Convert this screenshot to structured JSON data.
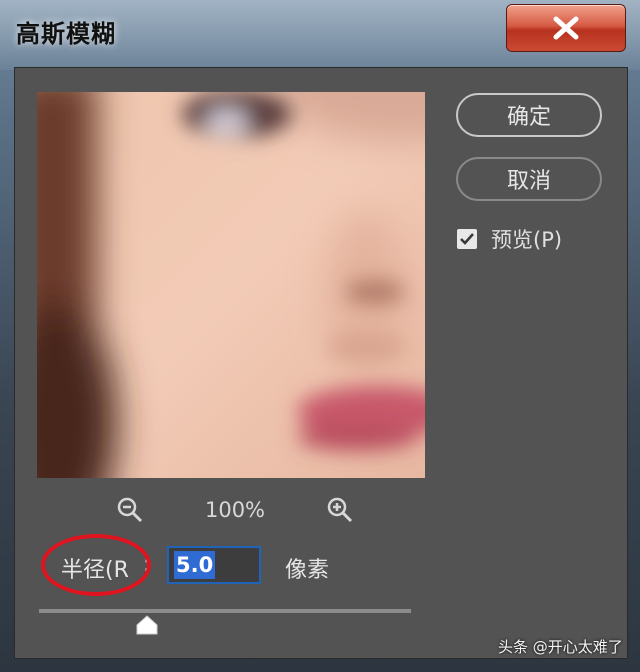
{
  "window": {
    "title": "高斯模糊",
    "close_icon": "close-icon"
  },
  "buttons": {
    "ok_label": "确定",
    "cancel_label": "取消"
  },
  "preview_toggle": {
    "label": "预览(P)",
    "checked": true
  },
  "zoom": {
    "level": "100%",
    "zoom_out_icon": "zoom-out-icon",
    "zoom_in_icon": "zoom-in-icon"
  },
  "radius": {
    "label": "半径(R",
    "colon": ":",
    "value": "5.0",
    "unit": "像素"
  },
  "slider": {
    "min": 0.1,
    "max": 1000,
    "value_fraction": 0.29
  },
  "watermark": "头条 @开心太难了",
  "colors": {
    "accent_selection": "#2f6bd3",
    "annotation_red": "#e0141e",
    "dialog_bg": "#535353"
  }
}
